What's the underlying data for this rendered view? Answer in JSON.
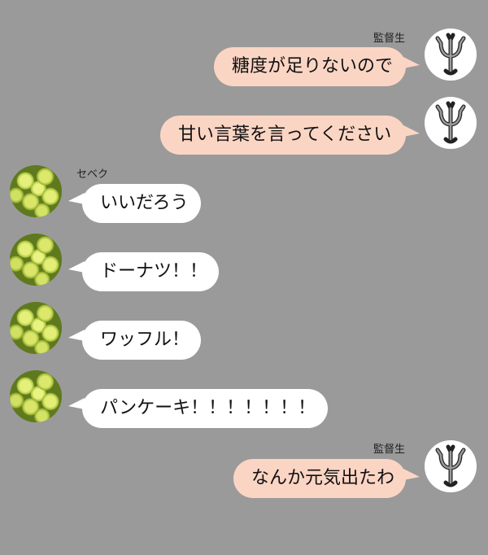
{
  "messages": [
    {
      "side": "right",
      "sender": "監督生",
      "text": "糖度が足りないので",
      "avatar_icon": "devil-trident-icon"
    },
    {
      "side": "right",
      "sender": "",
      "text": "甘い言葉を言ってください",
      "avatar_icon": "devil-trident-icon"
    },
    {
      "side": "left",
      "sender": "セベク",
      "text": "いいだろう",
      "avatar_icon": "green-grapes-icon"
    },
    {
      "side": "left",
      "sender": "",
      "text": "ドーナツ！！",
      "avatar_icon": "green-grapes-icon"
    },
    {
      "side": "left",
      "sender": "",
      "text": "ワッフル！",
      "avatar_icon": "green-grapes-icon"
    },
    {
      "side": "left",
      "sender": "",
      "text": "パンケーキ！！！！！！！",
      "avatar_icon": "green-grapes-icon"
    },
    {
      "side": "right",
      "sender": "監督生",
      "text": "なんか元気出たわ",
      "avatar_icon": "devil-trident-icon"
    }
  ],
  "colors": {
    "background": "#9a9a9a",
    "right_bubble": "#fbd5c4",
    "left_bubble": "#ffffff"
  }
}
